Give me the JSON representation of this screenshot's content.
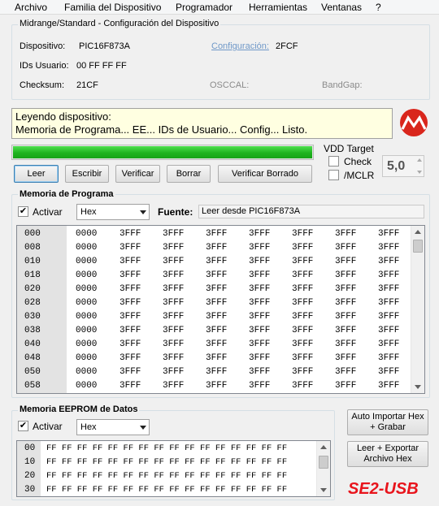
{
  "menu": [
    "Archivo",
    "Familia del Dispositivo",
    "Programador",
    "Herramientas",
    "Ventanas",
    "?"
  ],
  "config_group": {
    "title": "Midrange/Standard - Configuración del Dispositivo",
    "device_label": "Dispositivo:",
    "device_value": "PIC16F873A",
    "user_ids_label": "IDs Usuario:",
    "user_ids_value": "00 FF FF FF",
    "checksum_label": "Checksum:",
    "checksum_value": "21CF",
    "config_label": "Configuración:",
    "config_value": "2FCF",
    "osccal_label": "OSCCAL:",
    "bandgap_label": "BandGap:"
  },
  "status": {
    "line1": "Leyendo dispositivo:",
    "line2": "Memoria de Programa... EE... IDs de Usuario... Config... Listo.",
    "progress": 1.0,
    "progress_color": "#22c022"
  },
  "actions": {
    "read": "Leer",
    "write": "Escribir",
    "verify": "Verificar",
    "erase": "Borrar",
    "blank_check": "Verificar Borrado"
  },
  "vdd": {
    "title": "VDD Target",
    "check_label": "Check",
    "mclr_label": "/MCLR",
    "voltage": "5,0"
  },
  "program_memory": {
    "title": "Memoria de Programa",
    "enable_label": "Activar",
    "enabled": "✔",
    "format": "Hex",
    "source_label": "Fuente:",
    "source_value": "Leer desde PIC16F873A",
    "rows": [
      {
        "addr": "000",
        "cells": [
          "0000",
          "3FFF",
          "3FFF",
          "3FFF",
          "3FFF",
          "3FFF",
          "3FFF",
          "3FFF"
        ]
      },
      {
        "addr": "008",
        "cells": [
          "0000",
          "3FFF",
          "3FFF",
          "3FFF",
          "3FFF",
          "3FFF",
          "3FFF",
          "3FFF"
        ]
      },
      {
        "addr": "010",
        "cells": [
          "0000",
          "3FFF",
          "3FFF",
          "3FFF",
          "3FFF",
          "3FFF",
          "3FFF",
          "3FFF"
        ]
      },
      {
        "addr": "018",
        "cells": [
          "0000",
          "3FFF",
          "3FFF",
          "3FFF",
          "3FFF",
          "3FFF",
          "3FFF",
          "3FFF"
        ]
      },
      {
        "addr": "020",
        "cells": [
          "0000",
          "3FFF",
          "3FFF",
          "3FFF",
          "3FFF",
          "3FFF",
          "3FFF",
          "3FFF"
        ]
      },
      {
        "addr": "028",
        "cells": [
          "0000",
          "3FFF",
          "3FFF",
          "3FFF",
          "3FFF",
          "3FFF",
          "3FFF",
          "3FFF"
        ]
      },
      {
        "addr": "030",
        "cells": [
          "0000",
          "3FFF",
          "3FFF",
          "3FFF",
          "3FFF",
          "3FFF",
          "3FFF",
          "3FFF"
        ]
      },
      {
        "addr": "038",
        "cells": [
          "0000",
          "3FFF",
          "3FFF",
          "3FFF",
          "3FFF",
          "3FFF",
          "3FFF",
          "3FFF"
        ]
      },
      {
        "addr": "040",
        "cells": [
          "0000",
          "3FFF",
          "3FFF",
          "3FFF",
          "3FFF",
          "3FFF",
          "3FFF",
          "3FFF"
        ]
      },
      {
        "addr": "048",
        "cells": [
          "0000",
          "3FFF",
          "3FFF",
          "3FFF",
          "3FFF",
          "3FFF",
          "3FFF",
          "3FFF"
        ]
      },
      {
        "addr": "050",
        "cells": [
          "0000",
          "3FFF",
          "3FFF",
          "3FFF",
          "3FFF",
          "3FFF",
          "3FFF",
          "3FFF"
        ]
      },
      {
        "addr": "058",
        "cells": [
          "0000",
          "3FFF",
          "3FFF",
          "3FFF",
          "3FFF",
          "3FFF",
          "3FFF",
          "3FFF"
        ]
      }
    ]
  },
  "eeprom": {
    "title": "Memoria EEPROM de Datos",
    "enable_label": "Activar",
    "enabled": "✔",
    "format": "Hex",
    "rows": [
      {
        "addr": "00",
        "line": "FF FF FF FF FF FF FF FF FF FF FF FF FF FF FF FF"
      },
      {
        "addr": "10",
        "line": "FF FF FF FF FF FF FF FF FF FF FF FF FF FF FF FF"
      },
      {
        "addr": "20",
        "line": "FF FF FF FF FF FF FF FF FF FF FF FF FF FF FF FF"
      },
      {
        "addr": "30",
        "line": "FF FF FF FF FF FF FF FF FF FF FF FF FF FF FF FF"
      }
    ]
  },
  "side_buttons": {
    "auto_import_1": "Auto Importar Hex",
    "auto_import_2": "+ Grabar",
    "export_1": "Leer + Exportar",
    "export_2": "Archivo Hex"
  },
  "brand_text": "SE2-USB",
  "colors": {
    "brand_red": "#e8141c",
    "logo_red": "#d9261c"
  }
}
